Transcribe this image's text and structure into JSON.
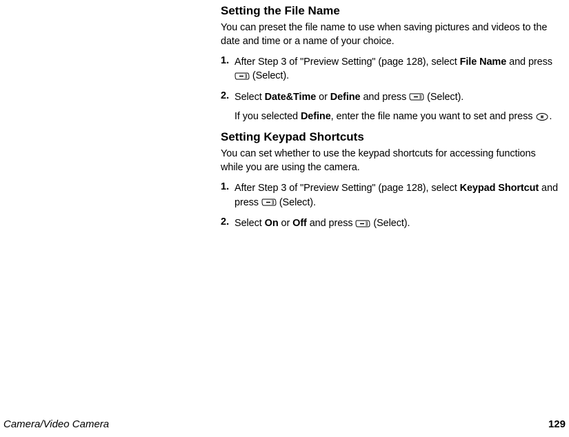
{
  "sections": {
    "filename": {
      "heading": "Setting the File Name",
      "intro": "You can preset the file name to use when saving pictures and videos to the date and time or a name of your choice.",
      "steps": [
        {
          "num": "1.",
          "pre": "After Step 3 of \"Preview Setting\" (page 128), select ",
          "bold1": "File Name",
          "mid1": " and press ",
          "post1": " (Select)."
        },
        {
          "num": "2.",
          "pre": "Select ",
          "bold1": "Date&Time",
          "mid1": " or ",
          "bold2": "Define",
          "mid2": " and press ",
          "post1": " (Select).",
          "sub_pre": "If you selected ",
          "sub_bold": "Define",
          "sub_mid": ", enter the file name you want to set and press ",
          "sub_post": "."
        }
      ]
    },
    "keypad": {
      "heading": "Setting Keypad Shortcuts",
      "intro": "You can set whether to use the keypad shortcuts for accessing functions while you are using the camera.",
      "steps": [
        {
          "num": "1.",
          "pre": "After Step 3 of \"Preview Setting\" (page 128), select ",
          "bold1": "Keypad Shortcut",
          "mid1": " and press ",
          "post1": " (Select)."
        },
        {
          "num": "2.",
          "pre": "Select ",
          "bold1": "On",
          "mid1": " or ",
          "bold2": "Off",
          "mid2": " and press ",
          "post1": " (Select)."
        }
      ]
    }
  },
  "footer": {
    "left": "Camera/Video Camera",
    "right": "129"
  }
}
